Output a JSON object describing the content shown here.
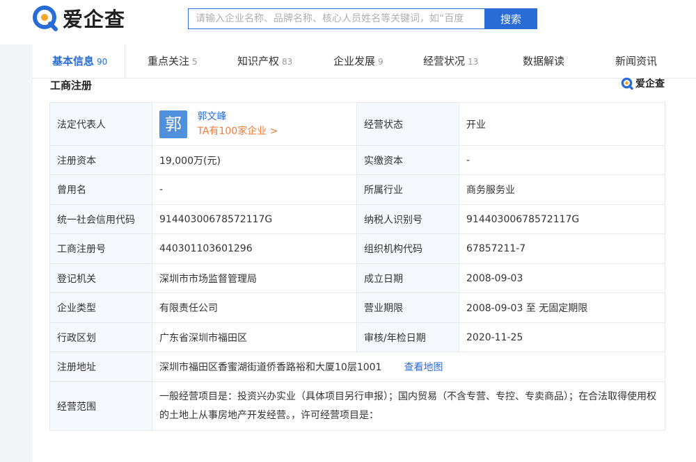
{
  "brand": {
    "name": "爱企查",
    "primary_color": "#2a6cd6",
    "logo_ring_color": "#2a6cd6",
    "logo_dot_color": "#f4a62a"
  },
  "search": {
    "placeholder": "请输入企业名称、品牌名称、核心人员姓名等关键词，如“百度",
    "button_label": "搜索"
  },
  "tabs": [
    {
      "label": "基本信息",
      "count": "90",
      "active": true
    },
    {
      "label": "重点关注",
      "count": "5"
    },
    {
      "label": "知识产权",
      "count": "83"
    },
    {
      "label": "企业发展",
      "count": "9"
    },
    {
      "label": "经营状况",
      "count": "13"
    },
    {
      "label": "数据解读",
      "count": ""
    },
    {
      "label": "新闻资讯",
      "count": ""
    }
  ],
  "section": {
    "title": "工商注册",
    "badge_text": "爱企查"
  },
  "legal_rep": {
    "label": "法定代表人",
    "avatar_char": "郭",
    "name": "郭文峰",
    "companies_link": "TA有100家企业 >"
  },
  "rows": [
    {
      "l1": "注册资本",
      "v1": "19,000万(元)",
      "l2": "实缴资本",
      "v2": "-"
    },
    {
      "l1": "曾用名",
      "v1": "-",
      "l2": "所属行业",
      "v2": "商务服务业"
    },
    {
      "l1": "统一社会信用代码",
      "v1": "91440300678572117G",
      "l2": "纳税人识别号",
      "v2": "91440300678572117G"
    },
    {
      "l1": "工商注册号",
      "v1": "440301103601296",
      "l2": "组织机构代码",
      "v2": "67857211-7"
    },
    {
      "l1": "登记机关",
      "v1": "深圳市市场监督管理局",
      "l2": "成立日期",
      "v2": "2008-09-03"
    },
    {
      "l1": "企业类型",
      "v1": "有限责任公司",
      "l2": "营业期限",
      "v2": "2008-09-03 至 无固定期限"
    },
    {
      "l1": "行政区划",
      "v1": "广东省深圳市福田区",
      "l2": "审核/年检日期",
      "v2": "2020-11-25"
    }
  ],
  "status": {
    "label": "经营状态",
    "value": "开业"
  },
  "address": {
    "label": "注册地址",
    "value": "深圳市福田区香蜜湖街道侨香路裕和大厦10层1001",
    "map_link": "查看地图"
  },
  "scope": {
    "label": "经营范围",
    "value": "一般经营项目是：投资兴办实业（具体项目另行申报）；国内贸易（不含专营、专控、专卖商品）；在合法取得使用权的土地上从事房地产开发经营。，许可经营项目是："
  }
}
